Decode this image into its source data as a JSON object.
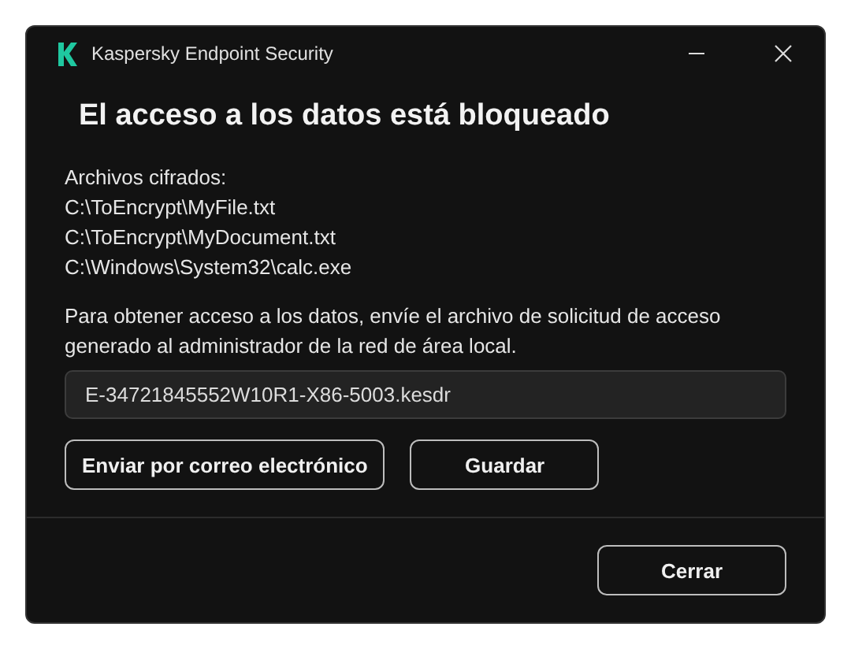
{
  "window": {
    "title": "Kaspersky Endpoint Security"
  },
  "heading": "El acceso a los datos está bloqueado",
  "files_label": "Archivos cifrados:",
  "files": [
    "C:\\ToEncrypt\\MyFile.txt",
    "C:\\ToEncrypt\\MyDocument.txt",
    "C:\\Windows\\System32\\calc.exe"
  ],
  "instructions": "Para obtener acceso a los datos, envíe el archivo de solicitud de acceso generado al administrador de la red de área local.",
  "request_file": {
    "value": "E-34721845552W10R1-X86-5003.kesdr"
  },
  "buttons": [
    "Enviar por correo electrónico",
    "Guardar"
  ],
  "footer_buttons": [
    "Cerrar"
  ]
}
